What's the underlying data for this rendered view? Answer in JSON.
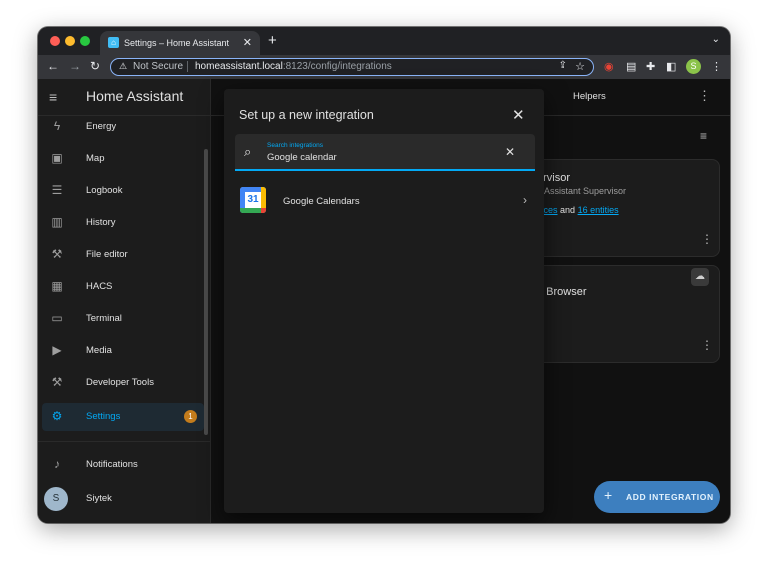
{
  "browser": {
    "tab_title": "Settings – Home Assistant",
    "tab_close": "✕",
    "new_tab": "+",
    "tab_menu": "⌄",
    "not_secure": "Not Secure",
    "url_host": "homeassistant.local",
    "url_path": ":8123/config/integrations",
    "profile_initial": "S",
    "colors": {
      "tabbar": "#202124",
      "toolbar": "#35363a",
      "omnibox_border": "#8ab4f8"
    }
  },
  "sidebar": {
    "title": "Home Assistant",
    "items": [
      {
        "label": "Energy",
        "icon": "lightning-icon"
      },
      {
        "label": "Map",
        "icon": "map-icon"
      },
      {
        "label": "Logbook",
        "icon": "list-icon"
      },
      {
        "label": "History",
        "icon": "chart-icon"
      },
      {
        "label": "File editor",
        "icon": "wrench-icon"
      },
      {
        "label": "HACS",
        "icon": "store-icon"
      },
      {
        "label": "Terminal",
        "icon": "terminal-icon"
      },
      {
        "label": "Media",
        "icon": "media-icon"
      },
      {
        "label": "Developer Tools",
        "icon": "hammer-icon"
      },
      {
        "label": "Settings",
        "icon": "gear-icon",
        "badge": "1",
        "active": true
      }
    ],
    "notifications": "Notifications",
    "user": {
      "name": "Siytek",
      "initial": "S"
    },
    "colors": {
      "active": "#03a9f4",
      "badge": "#c37c1c"
    }
  },
  "main": {
    "tab_helpers": "Helpers",
    "cards": [
      {
        "title_fragment": "ervisor",
        "subtitle_fragment": "e Assistant Supervisor",
        "link1": "vices",
        "and_text": "and",
        "link2": "16 entities"
      },
      {
        "title_fragment": "o Browser"
      }
    ],
    "fab_label": "ADD INTEGRATION",
    "fab_plus": "+"
  },
  "dialog": {
    "title": "Set up a new integration",
    "search_label": "Search integrations",
    "search_value": "Google calendar",
    "results": [
      {
        "name": "Google Calendars",
        "logo_number": "31"
      }
    ],
    "colors": {
      "accent": "#03a9f4"
    }
  }
}
